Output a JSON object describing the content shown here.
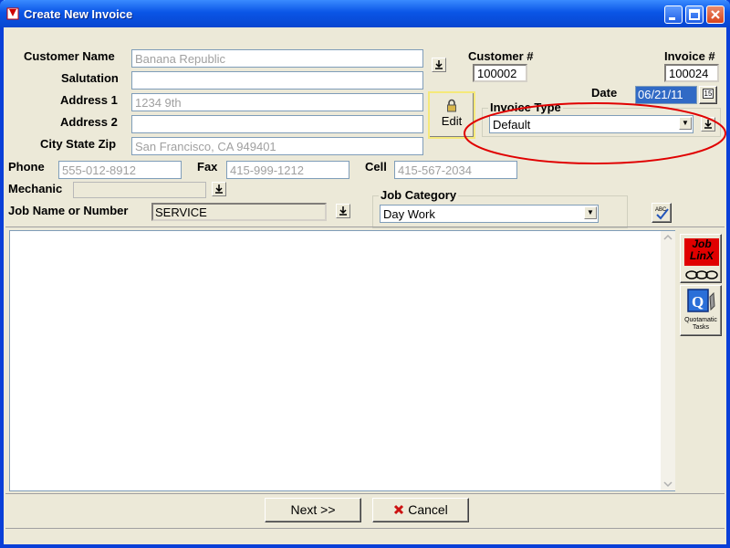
{
  "window": {
    "title": "Create New Invoice"
  },
  "customer": {
    "name_label": "Customer Name",
    "name_value": "Banana Republic",
    "salutation_label": "Salutation",
    "salutation_value": "",
    "address1_label": "Address 1",
    "address1_value": "1234 9th",
    "address2_label": "Address 2",
    "address2_value": "",
    "csz_label": "City State Zip",
    "csz_value": "San Francisco, CA 949401",
    "number_label": "Customer #",
    "number_value": "100002"
  },
  "edit_label": "Edit",
  "invoice": {
    "number_label": "Invoice #",
    "number_value": "100024",
    "date_label": "Date",
    "date_value": "06/21/11",
    "calendar_day": "15",
    "type_label": "Invoice Type",
    "type_value": "Default"
  },
  "contact": {
    "phone_label": "Phone",
    "phone_value": "555-012-8912",
    "fax_label": "Fax",
    "fax_value": "415-999-1212",
    "cell_label": "Cell",
    "cell_value": "415-567-2034",
    "mechanic_label": "Mechanic",
    "mechanic_value": ""
  },
  "job": {
    "name_label": "Job Name or Number",
    "name_value": "SERVICE",
    "category_label": "Job Category",
    "category_value": "Day Work"
  },
  "side_tools": {
    "joblinx_line1": "Job",
    "joblinx_line2": "LinX",
    "quotamatic_line1": "Quotamatic",
    "quotamatic_line2": "Tasks"
  },
  "spellcheck_text": "ABC",
  "buttons": {
    "next_label": "Next >>",
    "cancel_label": "Cancel"
  },
  "colors": {
    "annotation": "#e00000",
    "titlebar": "#0a55e6",
    "selection": "#316ac5"
  }
}
